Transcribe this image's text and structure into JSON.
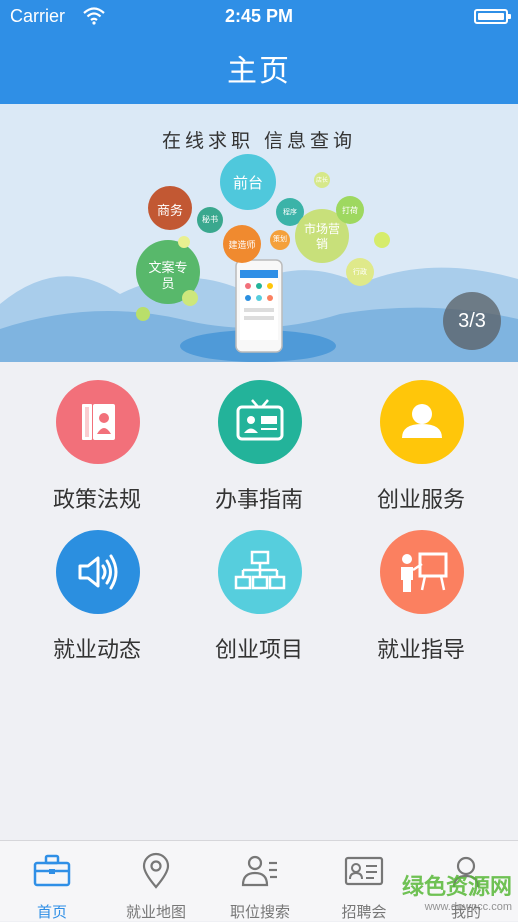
{
  "status": {
    "carrier": "Carrier",
    "time": "2:45 PM"
  },
  "nav": {
    "title": "主页"
  },
  "banner": {
    "headline": "在线求职  信息查询",
    "page_indicator": "3/3",
    "bubbles": [
      "前台",
      "商务",
      "秘书",
      "文案专员",
      "建造师",
      "策划",
      "市场营销",
      "程序",
      "打荷",
      "行政",
      "店长"
    ]
  },
  "grid": {
    "items": [
      {
        "label": "政策法规",
        "color": "#f2707a",
        "icon": "book-icon"
      },
      {
        "label": "办事指南",
        "color": "#23b39a",
        "icon": "tv-news-icon"
      },
      {
        "label": "创业服务",
        "color": "#ffc60a",
        "icon": "person-icon"
      },
      {
        "label": "就业动态",
        "color": "#2b8fe0",
        "icon": "speaker-icon"
      },
      {
        "label": "创业项目",
        "color": "#56cedd",
        "icon": "org-chart-icon"
      },
      {
        "label": "就业指导",
        "color": "#fb8060",
        "icon": "presentation-icon"
      }
    ]
  },
  "tabs": [
    {
      "label": "首页",
      "icon": "briefcase-icon",
      "active": true
    },
    {
      "label": "就业地图",
      "icon": "map-pin-icon",
      "active": false
    },
    {
      "label": "职位搜索",
      "icon": "user-search-icon",
      "active": false
    },
    {
      "label": "招聘会",
      "icon": "id-card-icon",
      "active": false
    },
    {
      "label": "我的",
      "icon": "profile-icon",
      "active": false
    }
  ],
  "watermark": {
    "text": "绿色资源网",
    "url": "www.downcc.com"
  }
}
